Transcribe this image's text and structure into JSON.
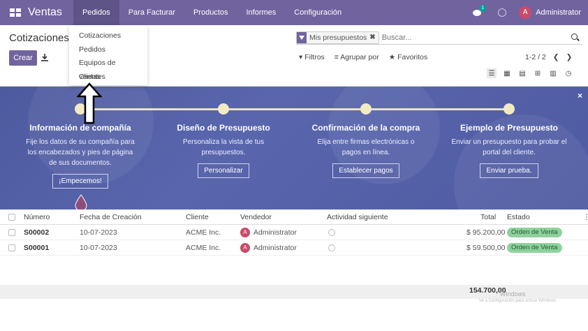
{
  "app": {
    "name": "Ventas"
  },
  "topnav": [
    "Pedidos",
    "Para Facturar",
    "Productos",
    "Informes",
    "Configuración"
  ],
  "chat_badge": "1",
  "user": {
    "initial": "A",
    "name": "Administrator"
  },
  "breadcrumb": "Cotizaciones",
  "create_label": "Crear",
  "search": {
    "facet": "Mis presupuestos",
    "facet_remove": "✖",
    "placeholder": "Buscar..."
  },
  "filters": {
    "filters": "Filtros",
    "group_by": "Agrupar por",
    "favorites": "Favoritos"
  },
  "pager": {
    "range": "1-2 / 2",
    "prev": "❮",
    "next": "❯"
  },
  "dropdown": [
    "Cotizaciones",
    "Pedidos",
    "Equipos de ventas",
    "Clientes"
  ],
  "banner": {
    "close": "×",
    "steps": [
      {
        "title": "Información de compañía",
        "desc": "Fije los datos de su compañía para los encabezados y pies de página de sus documentos.",
        "button": "¡Empecemos!"
      },
      {
        "title": "Diseño de Presupuesto",
        "desc": "Personaliza la vista de tus presupuestos.",
        "button": "Personalizar"
      },
      {
        "title": "Confirmación de la compra",
        "desc": "Elija entre firmas electrónicas o pagos en línea.",
        "button": "Establecer pagos"
      },
      {
        "title": "Ejemplo de Presupuesto",
        "desc": "Enviar un presupuesto para probar el portal del cliente.",
        "button": "Enviar prueba."
      }
    ]
  },
  "table": {
    "headers": {
      "number": "Número",
      "date": "Fecha de Creación",
      "customer": "Cliente",
      "salesperson": "Vendedor",
      "activity": "Actividad siguiente",
      "total": "Total",
      "state": "Estado"
    },
    "rows": [
      {
        "number": "S00002",
        "date": "10-07-2023",
        "customer": "ACME Inc.",
        "salesperson": "Administrator",
        "total": "$ 95.200,00",
        "state": "Orden de Venta"
      },
      {
        "number": "S00001",
        "date": "10-07-2023",
        "customer": "ACME Inc.",
        "salesperson": "Administrator",
        "total": "$ 59.500,00",
        "state": "Orden de Venta"
      }
    ],
    "sum_total": "154.700,00"
  },
  "watermark": {
    "title": "Windows",
    "subtitle": "Ve a Configuración para activar Windows."
  }
}
